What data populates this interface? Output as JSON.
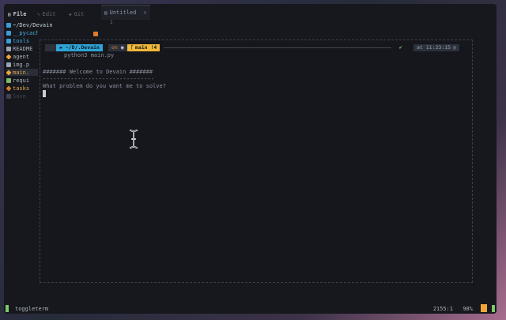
{
  "tabs": {
    "file": "File",
    "edit": "Edit",
    "git": "Git",
    "untitled": "Untitled",
    "untitled_sub": "1"
  },
  "sidebar": {
    "root": "~/Dev/Devain",
    "items": [
      {
        "label": "__pycache__",
        "kind": "folder"
      },
      {
        "label": "tools",
        "kind": "folder"
      },
      {
        "label": "README",
        "kind": "readme"
      },
      {
        "label": "agent",
        "kind": "py"
      },
      {
        "label": "img.p",
        "kind": "file"
      },
      {
        "label": "main.",
        "kind": "py"
      },
      {
        "label": "requi",
        "kind": "txt"
      },
      {
        "label": "tasks",
        "kind": "json"
      },
      {
        "label": "Save",
        "kind": "dim"
      }
    ]
  },
  "terminal": {
    "prompt": {
      "path": "~/D/.Devain",
      "on": "on",
      "branch": "main",
      "branch_status": "!4",
      "time_prefix": "at",
      "time": "11:23:15"
    },
    "command": "python3 main.py",
    "lines": [
      "####### Welcome to Devain #######",
      "--------------------------------",
      "What problem do you want me to solve?"
    ]
  },
  "statusbar": {
    "label": "toggleterm",
    "position": "2155:1",
    "percent": "98%"
  },
  "colors": {
    "accent_blue": "#2fa4d6",
    "accent_yellow": "#f0b93a",
    "accent_green": "#7fc76a",
    "accent_orange": "#e07a2b"
  }
}
